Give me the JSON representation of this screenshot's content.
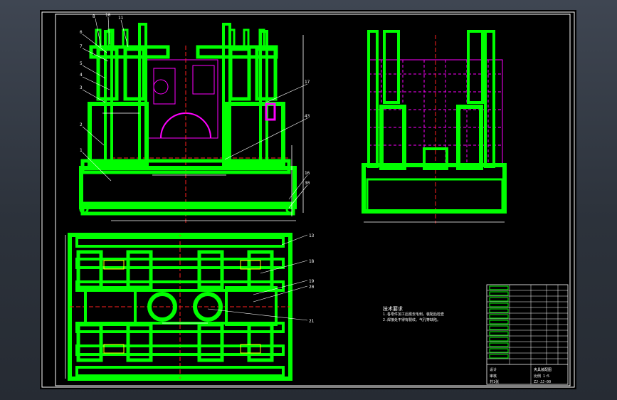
{
  "drawing": {
    "colors": {
      "sheet": "#000000",
      "frame": "#ffffff",
      "part": "#00ff00",
      "hidden_part": "#ff00ff",
      "centerline": "#ff2020",
      "dimension": "#ffffff",
      "leader": "#ffffff",
      "accent_yellow": "#ffff00"
    },
    "front_view_balloons": [
      "8",
      "10",
      "11",
      "6",
      "7",
      "5",
      "4",
      "3",
      "2",
      "1",
      "17",
      "43",
      "16",
      "30"
    ],
    "plan_view_balloons": [
      "13",
      "18",
      "19",
      "20",
      "21"
    ],
    "technical_requirements": {
      "title": "技术要求",
      "lines": [
        "1.各零件加工后需去毛刺，装配后检查",
        "2.焊接处不得有裂纹、气孔等缺陷。"
      ]
    },
    "title_block": {
      "drawing_name": "夹具装配图",
      "scale_label": "比例 1:5",
      "drawing_no": "ZJ-JJ-00",
      "designer": "设计",
      "checker": "审核",
      "sheet_label": "共1张"
    }
  }
}
